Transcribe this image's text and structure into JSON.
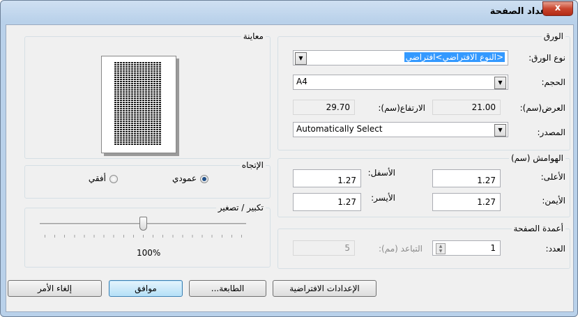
{
  "window": {
    "title": "إعداد الصفحة",
    "close_glyph": "x"
  },
  "paper": {
    "group_label": "الورق",
    "type_label": "نوع الورق:",
    "type_value": "<النوع الافتراضي>افتراضي",
    "size_label": "الحجم:",
    "size_value": "A4",
    "width_label": "العرض(سم):",
    "width_value": "21.00",
    "height_label": "الارتفاع(سم):",
    "height_value": "29.70",
    "source_label": "المصدر:",
    "source_value": "Automatically Select"
  },
  "margins": {
    "group_label": "الهوامش (سم)",
    "top_label": "الأعلى:",
    "top_value": "1.27",
    "bottom_label": "الأسفل:",
    "bottom_value": "1.27",
    "right_label": "الأيمن:",
    "right_value": "1.27",
    "left_label": "الأيسر:",
    "left_value": "1.27"
  },
  "columns": {
    "group_label": "أعمدة الصفحة",
    "count_label": "العدد:",
    "count_value": "1",
    "spacing_label": "التباعد (مم):",
    "spacing_value": "5"
  },
  "preview": {
    "group_label": "معاينة"
  },
  "orientation": {
    "group_label": "الإتجاه",
    "portrait_label": "عمودي",
    "landscape_label": "أفقي",
    "selected": "portrait"
  },
  "scale": {
    "group_label": "تكبير / تصغير",
    "value_text": "100%",
    "slider_fraction": 0.5
  },
  "buttons": {
    "defaults": "الإعدادات الافتراضية",
    "printer": "الطابعة...",
    "ok": "موافق",
    "cancel": "إلغاء الأمر"
  },
  "icons": {
    "close": "close-icon",
    "dropdown": "chevron-down-icon",
    "spin": "spin-arrows-icon"
  }
}
